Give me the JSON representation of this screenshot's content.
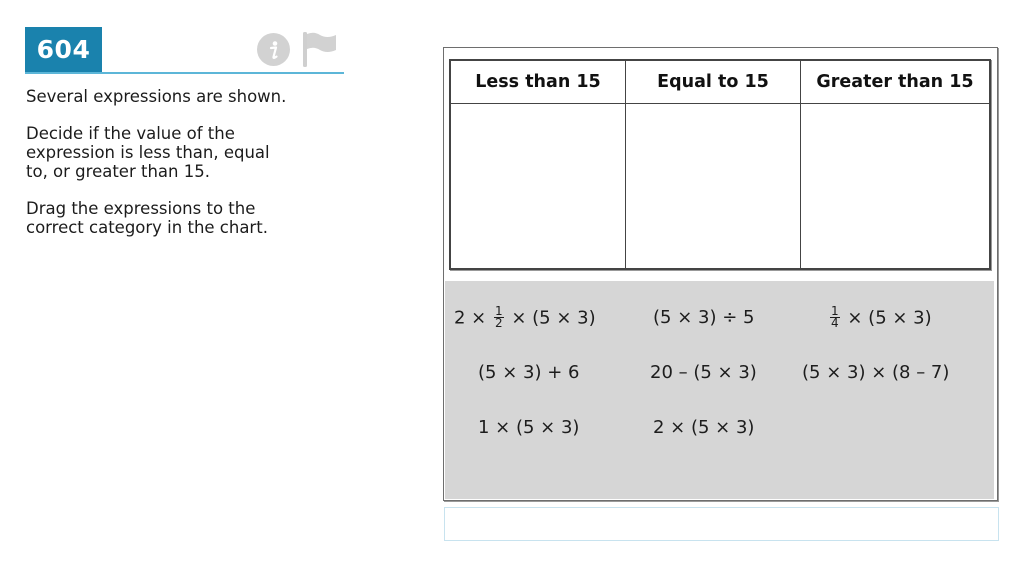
{
  "question": {
    "number": "604",
    "info_icon": "info-icon",
    "flag_icon": "flag-icon",
    "accent_color": "#1a82ad",
    "stem": [
      [
        "Several expressions are shown."
      ],
      [
        "Decide if the value of the",
        "expression is less than, equal",
        "to, or greater than 15."
      ],
      [
        "Drag the expressions to the",
        "correct category in the chart."
      ]
    ]
  },
  "chart": {
    "headers": [
      "Less than 15",
      "Equal to 15",
      "Greater than 15"
    ]
  },
  "expressions": [
    {
      "pre": "2 × ",
      "frac": {
        "num": "1",
        "den": "2"
      },
      "post": " × (5 × 3)"
    },
    {
      "pre": "(5 × 3) ÷ 5"
    },
    {
      "pre": "",
      "frac": {
        "num": "1",
        "den": "4"
      },
      "post": " × (5 × 3)"
    },
    {
      "pre": "(5 × 3) + 6"
    },
    {
      "pre": "20 – (5 × 3)"
    },
    {
      "pre": "(5 × 3) × (8 – 7)"
    },
    {
      "pre": "1 × (5 × 3)"
    },
    {
      "pre": "2 × (5 × 3)"
    }
  ],
  "answer_box": {
    "value": ""
  }
}
